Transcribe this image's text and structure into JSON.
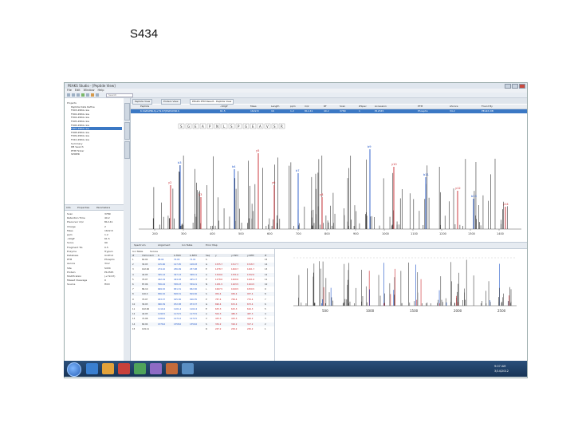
{
  "slide": {
    "title": "S434"
  },
  "window": {
    "title": "PEAKS Studio - [Peptide View]",
    "menu": [
      "File",
      "Edit",
      "Window",
      "Help"
    ],
    "search_placeholder": "Search"
  },
  "project_tree": {
    "items": [
      "Projects",
      "Peptide Data Refine",
      "F003-2BAS.raw",
      "F002-2BAS.raw",
      "F004-2BAS.raw",
      "F005-2BAS.raw",
      "F006-2BAS.raw",
      "F007-2BAS.raw",
      "F008-2BAS.raw",
      "F009-2BAS.raw",
      "F010-2BAS.raw",
      "Summary",
      "DB Search",
      "PTM Finder",
      "SPIDER"
    ],
    "selected_index": 7
  },
  "left_tabs": [
    "Info",
    "Properties",
    "Parameters"
  ],
  "properties": [
    [
      "Scan",
      "3789"
    ],
    [
      "Retention Time",
      "40.2"
    ],
    [
      "Precursor m/z",
      "812.41"
    ],
    [
      "Charge",
      "2"
    ],
    [
      "Mass",
      "1622.8"
    ],
    [
      "ppm",
      "1.2"
    ],
    [
      "-10lgP",
      "61.5"
    ],
    [
      "Score",
      "99"
    ],
    [
      "Fragment Tol.",
      "0.5"
    ],
    [
      "Enzyme",
      "Trypsin"
    ],
    [
      "Database",
      "UniProt"
    ],
    [
      "PTM",
      "Phospho"
    ],
    [
      "Ascore",
      "34.2"
    ],
    [
      "Site",
      "S434"
    ],
    [
      "Protein",
      "P12345"
    ],
    [
      "Modification",
      "(+79.97)"
    ],
    [
      "Missed Cleavage",
      "0"
    ],
    [
      "Source",
      "HCD"
    ]
  ],
  "doc_tabs": [
    "Peptide View",
    "Protein View",
    "PEAKS PTM Result - Peptide View"
  ],
  "psm_table": {
    "headers": [
      "Peptide",
      "-10lgP",
      "Mass",
      "Length",
      "ppm",
      "m/z",
      "RT",
      "Scan",
      "#Spec",
      "Accession",
      "PTM",
      "AScore",
      "Found By"
    ],
    "row": [
      "K.SGEAPNLS(+79.97)PGEAVSR.S",
      "61.5",
      "1622.8",
      "16",
      "1.2",
      "812.41",
      "40.2",
      "3789",
      "1",
      "P12345",
      "Phospho",
      "34.2",
      "PEAKS DB"
    ]
  },
  "spectrum": {
    "sequence": [
      "S",
      "G",
      "E",
      "A",
      "P",
      "N",
      "L",
      "S",
      "P",
      "G",
      "E",
      "A",
      "V",
      "S",
      "R"
    ],
    "xticks": [
      "200",
      "300",
      "400",
      "500",
      "600",
      "700",
      "800",
      "900",
      "1000",
      "1100",
      "1200",
      "1300",
      "1400"
    ],
    "labels": [
      "y2",
      "b3",
      "y3",
      "b4",
      "y5",
      "y6",
      "b7",
      "y8",
      "b9",
      "y10",
      "b11",
      "y12",
      "b13",
      "y14"
    ]
  },
  "bottom_tabs": [
    "Spectrum",
    "Alignment",
    "Ion Table",
    "Error Map"
  ],
  "frag_table": {
    "tabs": [
      "Ion Table",
      "Scores"
    ],
    "headers": [
      "#",
      "Immonium",
      "b",
      "b-H2O",
      "b-NH3",
      "Seq",
      "y",
      "y-H2O",
      "y-NH3",
      "#"
    ],
    "rows": [
      [
        "1",
        "60.04",
        "88.04",
        "70.03",
        "71.01",
        "S",
        "",
        "",
        "",
        "15"
      ],
      [
        "2",
        "30.03",
        "145.06",
        "127.05",
        "128.03",
        "G",
        "1535.7",
        "1517.7",
        "1518.7",
        "14"
      ],
      [
        "3",
        "102.06",
        "274.10",
        "256.09",
        "257.08",
        "E",
        "1478.7",
        "1460.7",
        "1461.7",
        "13"
      ],
      [
        "4",
        "44.05",
        "345.14",
        "327.13",
        "328.11",
        "A",
        "1349.6",
        "1331.6",
        "1332.6",
        "12"
      ],
      [
        "5",
        "70.07",
        "442.19",
        "424.18",
        "425.17",
        "P",
        "1278.6",
        "1260.6",
        "1261.6",
        "11"
      ],
      [
        "6",
        "87.06",
        "556.24",
        "538.23",
        "539.21",
        "N",
        "1181.5",
        "1163.5",
        "1164.5",
        "10"
      ],
      [
        "7",
        "86.10",
        "669.32",
        "651.31",
        "652.30",
        "L",
        "1067.5",
        "1049.5",
        "1050.5",
        "9"
      ],
      [
        "8",
        "140.0",
        "836.32",
        "818.31",
        "819.30",
        "S",
        "954.4",
        "936.4",
        "937.4",
        "8"
      ],
      [
        "9",
        "70.07",
        "933.37",
        "915.36",
        "916.35",
        "P",
        "787.4",
        "769.4",
        "770.4",
        "7"
      ],
      [
        "10",
        "30.03",
        "990.39",
        "972.38",
        "973.37",
        "G",
        "690.4",
        "672.4",
        "673.4",
        "6"
      ],
      [
        "11",
        "102.06",
        "1119.4",
        "1101.4",
        "1102.4",
        "E",
        "633.3",
        "615.3",
        "616.3",
        "5"
      ],
      [
        "12",
        "44.05",
        "1190.5",
        "1172.5",
        "1173.5",
        "A",
        "504.3",
        "486.3",
        "487.3",
        "4"
      ],
      [
        "13",
        "72.08",
        "1289.6",
        "1271.6",
        "1272.5",
        "V",
        "433.3",
        "415.3",
        "416.2",
        "3"
      ],
      [
        "14",
        "60.04",
        "1376.6",
        "1358.6",
        "1359.6",
        "S",
        "334.2",
        "316.2",
        "317.2",
        "2"
      ],
      [
        "15",
        "129.11",
        "",
        "",
        "",
        "R",
        "247.2",
        "229.2",
        "230.2",
        "1"
      ]
    ]
  },
  "mini_spectrum": {
    "xticks": [
      "500",
      "1000",
      "1500",
      "2000",
      "2500"
    ]
  },
  "taskbar": {
    "time": "9:07 AM",
    "date": "3/14/2012"
  }
}
